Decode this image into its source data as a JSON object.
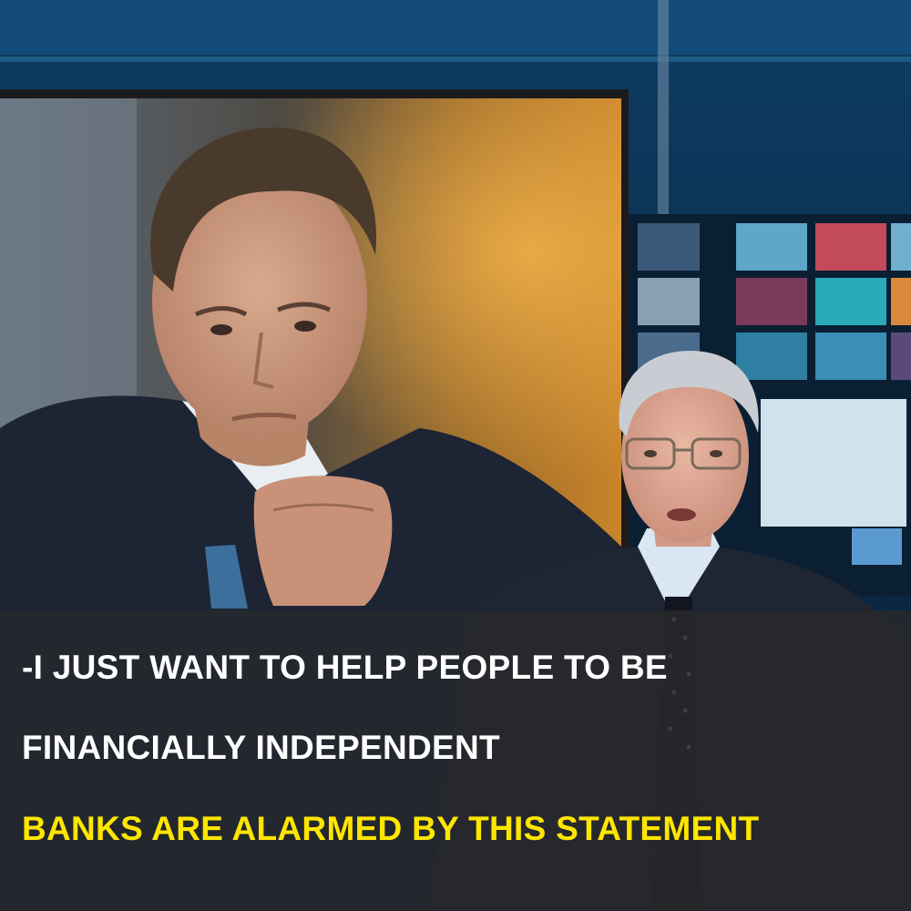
{
  "caption": {
    "line1": "-I JUST WANT TO HELP PEOPLE TO BE",
    "line2": "FINANCIALLY INDEPENDENT",
    "line3": "BANKS ARE ALARMED BY THIS STATEMENT"
  },
  "colors": {
    "caption_text": "#ffffff",
    "headline_text": "#ffe600",
    "caption_bg": "#28292c",
    "studio_bg": "#0d2a45"
  }
}
